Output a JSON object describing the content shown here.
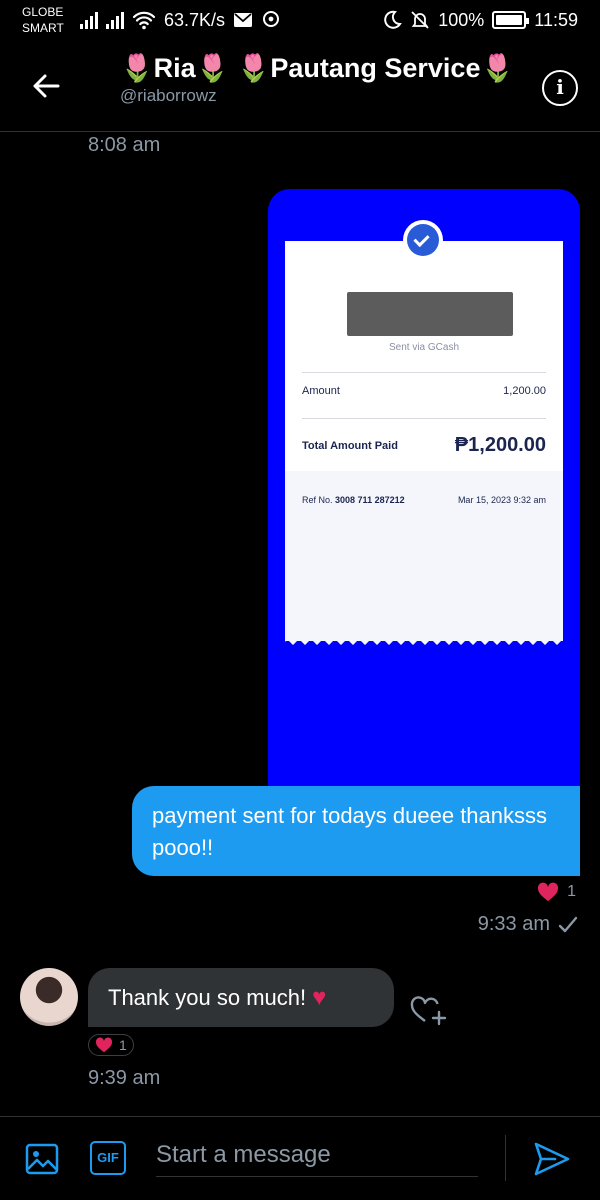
{
  "status_bar": {
    "carrier_line1": "GLOBE",
    "carrier_line2": "SMART",
    "network_speed": "63.7K/s",
    "battery": "100%",
    "time": "11:59"
  },
  "header": {
    "title": "🌷Ria🌷 🌷Pautang Service🌷",
    "handle": "@riaborrowz"
  },
  "messages": {
    "timestamp_top": "8:08 am",
    "receipt": {
      "sent_via": "Sent via GCash",
      "amount_label": "Amount",
      "amount_value": "1,200.00",
      "total_label": "Total Amount Paid",
      "total_value": "₱1,200.00",
      "ref_label": "Ref No.",
      "ref_value": "3008 711 287212",
      "date": "Mar 15, 2023 9:32 am"
    },
    "outgoing_text": "payment sent for todays dueee thanksss pooo!!",
    "outgoing_reaction_count": "1",
    "outgoing_time": "9:33 am",
    "incoming_text": "Thank you so much!",
    "incoming_emoji": "♥",
    "incoming_reaction_count": "1",
    "incoming_time": "9:39 am"
  },
  "composer": {
    "gif_label": "GIF",
    "placeholder": "Start a message"
  },
  "colors": {
    "accent": "#1d9bf0",
    "heart": "#e0245e",
    "media_bg": "#0000ff",
    "incoming_bubble": "#2f3336"
  },
  "icons": [
    "back-arrow-icon",
    "info-icon",
    "image-icon",
    "gif-icon",
    "send-icon",
    "heart-icon",
    "add-reaction-icon",
    "checkmark-icon"
  ]
}
